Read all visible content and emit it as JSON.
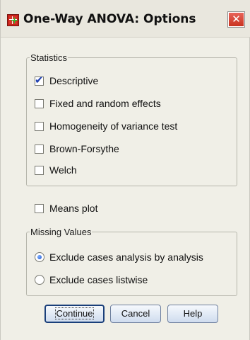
{
  "window": {
    "title": "One-Way ANOVA: Options",
    "close_icon": "close-x-icon",
    "app_icon": "spss-table-icon"
  },
  "statistics": {
    "legend": "Statistics",
    "items": [
      {
        "label": "Descriptive",
        "checked": true
      },
      {
        "label": "Fixed and random effects",
        "checked": false
      },
      {
        "label": "Homogeneity of variance test",
        "checked": false
      },
      {
        "label": "Brown-Forsythe",
        "checked": false
      },
      {
        "label": "Welch",
        "checked": false
      }
    ]
  },
  "means_plot": {
    "label": "Means plot",
    "checked": false
  },
  "missing_values": {
    "legend": "Missing Values",
    "options": [
      {
        "label": "Exclude cases analysis by analysis",
        "selected": true
      },
      {
        "label": "Exclude cases listwise",
        "selected": false
      }
    ]
  },
  "buttons": {
    "continue": "Continue",
    "cancel": "Cancel",
    "help": "Help"
  }
}
